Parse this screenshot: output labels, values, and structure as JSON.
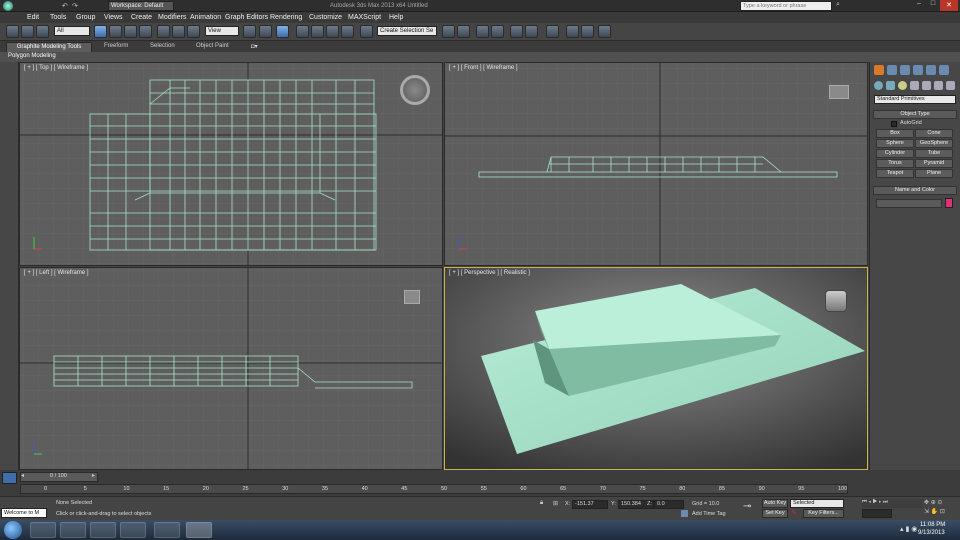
{
  "titlebar": {
    "workspace": "Workspace: Default",
    "title": "Autodesk 3ds Max 2013 x64    Untitled",
    "search_placeholder": "Type a keyword or phrase"
  },
  "menu": [
    "Edit",
    "Tools",
    "Group",
    "Views",
    "Create",
    "Modifiers",
    "Animation",
    "Graph Editors",
    "Rendering",
    "Customize",
    "MAXScript",
    "Help"
  ],
  "toolbar": {
    "filter_value": "All",
    "ref_coord_value": "View",
    "selection_set_value": "Create Selection Se"
  },
  "ribbon": {
    "tabs": [
      "Graphite Modeling Tools",
      "Freeform",
      "Selection",
      "Object Paint"
    ],
    "subtab": "Polygon Modeling"
  },
  "viewports": {
    "top": "[ + ] [ Top ] [ Wireframe ]",
    "front": "[ + ] [ Front ] [ Wireframe ]",
    "left": "[ + ] [ Left ] [ Wireframe ]",
    "perspective": "[ + ] [ Perspective ] [ Realistic ]"
  },
  "command_panel": {
    "category_value": "Standard Primitives",
    "object_type_title": "Object Type",
    "autogrid_label": "AutoGrid",
    "buttons": [
      "Box",
      "Cone",
      "Sphere",
      "GeoSphere",
      "Cylinder",
      "Tube",
      "Torus",
      "Pyramid",
      "Teapot",
      "Plane"
    ],
    "name_color_title": "Name and Color",
    "object_color": "#e0307a"
  },
  "timeline": {
    "slider_label": "0 / 100",
    "ticks": [
      "0",
      "5",
      "10",
      "15",
      "20",
      "25",
      "30",
      "35",
      "40",
      "45",
      "50",
      "55",
      "60",
      "65",
      "70",
      "75",
      "80",
      "85",
      "90",
      "95",
      "100"
    ]
  },
  "status": {
    "selection_text": "None Selected",
    "prompt_text": "Click or click-and-drag to select objects",
    "maxscript_text": "Welcome to M",
    "x_label": "X:",
    "x_value": "-151.37",
    "y_label": "Y:",
    "y_value": "150.384",
    "z_label": "Z:",
    "z_value": "0.0",
    "grid_text": "Grid = 10.0",
    "add_time_tag": "Add Time Tag",
    "auto_key": "Auto Key",
    "set_key": "Set Key",
    "key_mode_value": "Selected",
    "key_filters": "Key Filters..."
  },
  "taskbar": {
    "time": "11:08 PM",
    "date": "9/13/2013"
  },
  "colors": {
    "wire": "#a8e3c8",
    "model_fill": "#a2dcc3",
    "active_border": "#c9b44a"
  }
}
